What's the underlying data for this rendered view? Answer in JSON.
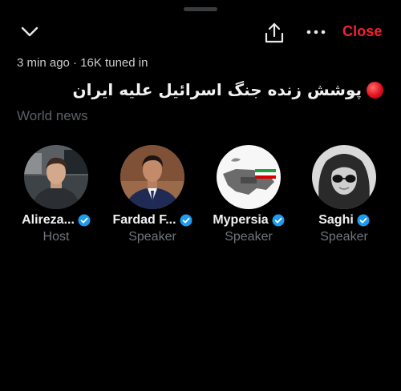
{
  "header": {
    "close_label": "Close"
  },
  "space": {
    "meta": "3 min ago · 16K tuned in",
    "title": "پوشش زنده جنگ اسرائیل علیه ایران",
    "topic": "World news"
  },
  "participants": [
    {
      "name": "Alireza...",
      "role": "Host",
      "verified": true
    },
    {
      "name": "Fardad F...",
      "role": "Speaker",
      "verified": true
    },
    {
      "name": "Mypersia",
      "role": "Speaker",
      "verified": true
    },
    {
      "name": "Saghi",
      "role": "Speaker",
      "verified": true
    }
  ],
  "colors": {
    "background": "#000000",
    "close_red": "#f4212e",
    "verified_blue": "#1d9bf0",
    "muted_text": "#6e767d"
  },
  "icons": {
    "collapse": "chevron-down-icon",
    "share": "share-icon",
    "more": "more-options-icon",
    "live": "live-red-dot-icon",
    "verified": "verified-badge-icon"
  }
}
